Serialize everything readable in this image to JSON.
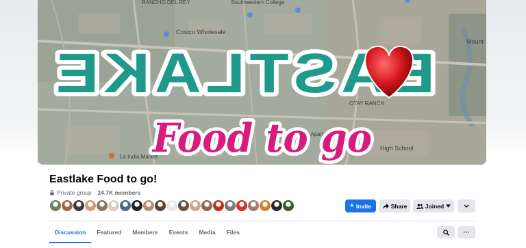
{
  "cover": {
    "map_labels": [
      "RANCHO DEL REY",
      "Southwestern College",
      "Costco Wholesale",
      "OTAY RANCH",
      "Lavera Apartments",
      "La India Market",
      "High School",
      "Mount"
    ],
    "headline": "EASTLAKE",
    "subline": "Food to go"
  },
  "group": {
    "name": "Eastlake Food to go!",
    "privacy": "Private group",
    "separator": "·",
    "members": "24.7K members"
  },
  "actions": {
    "invite": "Invite",
    "share": "Share",
    "joined": "Joined"
  },
  "tabs": [
    "Discussion",
    "Featured",
    "Members",
    "Events",
    "Media",
    "Files"
  ],
  "icons": {
    "invite": "plus-icon",
    "share": "share-arrow-icon",
    "joined": "people-icon",
    "more": "chevron-down-icon",
    "search": "search-icon",
    "options": "ellipsis-icon"
  },
  "colors": {
    "accent": "#1b74e4",
    "headline": "#1f9a8a",
    "subline": "#d81b7c",
    "heart": "#d3141b"
  },
  "member_avatar_colors": [
    "#6d7f5a",
    "#a06a48",
    "#3b3b3b",
    "#caa07a",
    "#8a7460",
    "#e0c9c0",
    "#4a6a8a",
    "#222222",
    "#b89070",
    "#5a4030",
    "#e8e8e8",
    "#6a5040",
    "#d4a483",
    "#8c6a50",
    "#c03020",
    "#7a7a7a",
    "#d33030",
    "#9a8070",
    "#d08030",
    "#2a2a2a",
    "#3a5a2a"
  ]
}
